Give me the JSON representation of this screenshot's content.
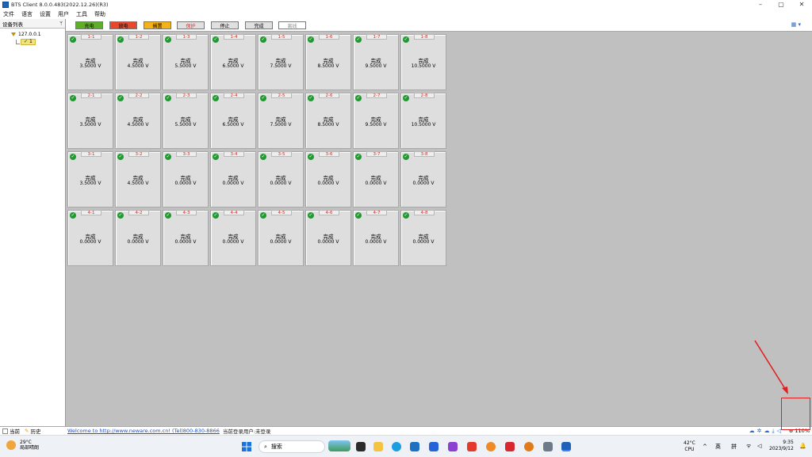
{
  "window": {
    "title": "BTS Client 8.0.0.483(2022.12.26)(R3)",
    "minimize": "–",
    "maximize": "▢",
    "close": "✕"
  },
  "menu": [
    "文件",
    "语言",
    "设置",
    "用户",
    "工具",
    "帮助"
  ],
  "sidebar": {
    "title": "设备列表",
    "pin": "ᛘ",
    "root": "127.0.0.1",
    "child": "1"
  },
  "toolbar": {
    "buttons": [
      {
        "label": "充电",
        "color": "#5fae27",
        "text": "#000"
      },
      {
        "label": "放电",
        "color": "#e8472b",
        "text": "#000"
      },
      {
        "label": "搁置",
        "color": "#f3b21a",
        "text": "#000"
      },
      {
        "label": "保护",
        "color": "#e0e0e0",
        "text": "#e0302c"
      },
      {
        "label": "停止",
        "color": "#e0e0e0",
        "text": "#000"
      },
      {
        "label": "完成",
        "color": "#e0e0e0",
        "text": "#000"
      },
      {
        "label": "离线",
        "color": "#ffffff",
        "text": "#8a8a8a"
      }
    ],
    "view_icon": "▦ ▾"
  },
  "channels": [
    [
      {
        "id": "1-1",
        "status": "完成",
        "value": "3.5000 V"
      },
      {
        "id": "1-2",
        "status": "完成",
        "value": "4.5000 V"
      },
      {
        "id": "1-3",
        "status": "完成",
        "value": "5.5000 V"
      },
      {
        "id": "1-4",
        "status": "完成",
        "value": "6.5000 V"
      },
      {
        "id": "1-5",
        "status": "完成",
        "value": "7.5000 V"
      },
      {
        "id": "1-6",
        "status": "完成",
        "value": "8.5000 V"
      },
      {
        "id": "1-7",
        "status": "完成",
        "value": "9.5000 V"
      },
      {
        "id": "1-8",
        "status": "完成",
        "value": "10.5000 V"
      }
    ],
    [
      {
        "id": "2-1",
        "status": "完成",
        "value": "3.5000 V"
      },
      {
        "id": "2-2",
        "status": "完成",
        "value": "4.5000 V"
      },
      {
        "id": "2-3",
        "status": "完成",
        "value": "5.5000 V"
      },
      {
        "id": "2-4",
        "status": "完成",
        "value": "6.5000 V"
      },
      {
        "id": "2-5",
        "status": "完成",
        "value": "7.5000 V"
      },
      {
        "id": "2-6",
        "status": "完成",
        "value": "8.5000 V"
      },
      {
        "id": "2-7",
        "status": "完成",
        "value": "9.5000 V"
      },
      {
        "id": "2-8",
        "status": "完成",
        "value": "10.5000 V"
      }
    ],
    [
      {
        "id": "3-1",
        "status": "完成",
        "value": "3.5000 V"
      },
      {
        "id": "3-2",
        "status": "完成",
        "value": "4.5000 V"
      },
      {
        "id": "3-3",
        "status": "完成",
        "value": "0.0000 V"
      },
      {
        "id": "3-4",
        "status": "完成",
        "value": "0.0000 V"
      },
      {
        "id": "3-5",
        "status": "完成",
        "value": "0.0000 V"
      },
      {
        "id": "3-6",
        "status": "完成",
        "value": "0.0000 V"
      },
      {
        "id": "3-7",
        "status": "完成",
        "value": "0.0000 V"
      },
      {
        "id": "3-8",
        "status": "完成",
        "value": "0.0000 V"
      }
    ],
    [
      {
        "id": "4-1",
        "status": "完成",
        "value": "0.0000 V"
      },
      {
        "id": "4-2",
        "status": "完成",
        "value": "0.0000 V"
      },
      {
        "id": "4-3",
        "status": "完成",
        "value": "0.0000 V"
      },
      {
        "id": "4-4",
        "status": "完成",
        "value": "0.0000 V"
      },
      {
        "id": "4-5",
        "status": "完成",
        "value": "0.0000 V"
      },
      {
        "id": "4-6",
        "status": "完成",
        "value": "0.0000 V"
      },
      {
        "id": "4-7",
        "status": "完成",
        "value": "0.0000 V"
      },
      {
        "id": "4-8",
        "status": "完成",
        "value": "0.0000 V"
      }
    ]
  ],
  "bottom_tabs": {
    "current": "当前",
    "history": "历史"
  },
  "status": {
    "link": "Welcome to http://www.neware.com.cn! (Tel)800-830-8866",
    "user": "当前登录用户:未登录",
    "zoom": "110%"
  },
  "taskbar": {
    "weather_temp": "29°C",
    "weather_desc": "局部晴朗",
    "search": "搜索",
    "cpu_temp": "42°C",
    "cpu_label": "CPU",
    "ime1": "英",
    "ime2": "拼",
    "time": "9:35",
    "date": "2023/9/12"
  }
}
